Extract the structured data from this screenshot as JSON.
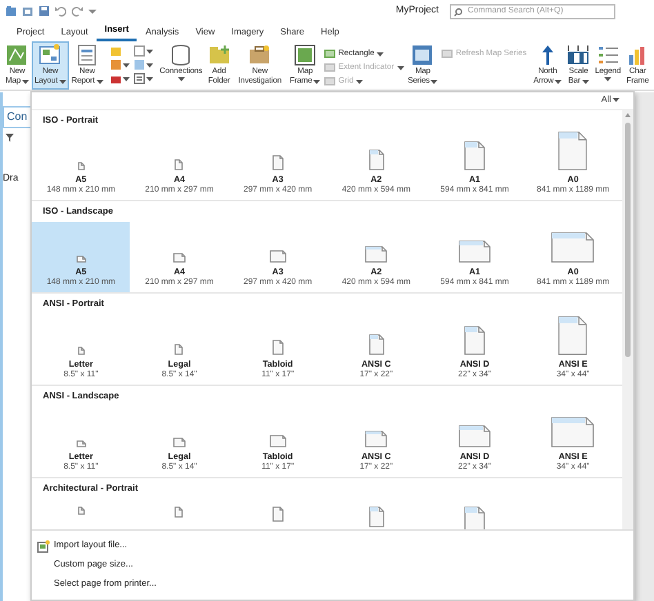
{
  "title_bar": {
    "title": "MyProject",
    "search": {
      "placeholder": "Command Search (Alt+Q)"
    }
  },
  "tabs": [
    {
      "label": "Project",
      "selected": false
    },
    {
      "label": "Layout",
      "selected": false
    },
    {
      "label": "Insert",
      "selected": true
    },
    {
      "label": "Analysis",
      "selected": false
    },
    {
      "label": "View",
      "selected": false
    },
    {
      "label": "Imagery",
      "selected": false
    },
    {
      "label": "Share",
      "selected": false
    },
    {
      "label": "Help",
      "selected": false
    }
  ],
  "ribbon": [
    {
      "kind": "large",
      "label": "New Map",
      "dropdown": true,
      "selected": false
    },
    {
      "kind": "large",
      "label": "New Layout",
      "dropdown": true,
      "selected": true
    },
    {
      "kind": "large",
      "label": "New Report",
      "dropdown": true,
      "selected": false
    },
    {
      "kind": "icons",
      "items": [
        {
          "dropdown": false
        },
        {
          "dropdown": true
        },
        {
          "dropdown": true
        },
        {
          "dropdown": true
        },
        {
          "dropdown": true
        },
        {
          "dropdown": true
        }
      ]
    },
    {
      "kind": "large",
      "label": "Connections",
      "dropdown": true,
      "selected": false
    },
    {
      "kind": "large",
      "label": "Add Folder",
      "dropdown": false,
      "selected": false
    },
    {
      "kind": "separator"
    },
    {
      "kind": "large",
      "label": "New Investigation",
      "dropdown": false,
      "selected": false
    },
    {
      "kind": "separator"
    },
    {
      "kind": "large",
      "label": "Map Frame",
      "dropdown": true,
      "selected": false
    },
    {
      "kind": "small",
      "items": [
        {
          "label": "Rectangle",
          "dropdown": true,
          "disabled": false
        },
        {
          "label": "Extent Indicator",
          "dropdown": true,
          "disabled": true
        },
        {
          "label": "Grid",
          "dropdown": true,
          "disabled": true
        }
      ]
    },
    {
      "kind": "large",
      "label": "Map Series",
      "dropdown": true,
      "selected": false
    },
    {
      "kind": "small",
      "items": [
        {
          "label": "Refresh Map Series",
          "dropdown": false,
          "disabled": true
        }
      ]
    },
    {
      "kind": "separator"
    },
    {
      "kind": "large",
      "label": "North Arrow",
      "dropdown": true,
      "selected": false
    },
    {
      "kind": "large",
      "label": "Scale Bar",
      "dropdown": true,
      "selected": false
    },
    {
      "kind": "large",
      "label": "Legend",
      "dropdown": true,
      "selected": false
    },
    {
      "kind": "large",
      "label": "Char Frame",
      "dropdown": false,
      "selected": false
    }
  ],
  "side_panel": {
    "tab": "Con",
    "heading": "Dra"
  },
  "gallery": {
    "filter": "All",
    "sections": [
      {
        "title": "ISO - Portrait",
        "kind": "portrait",
        "items": [
          {
            "name": "A5",
            "size": "148 mm x 210 mm",
            "selected": false
          },
          {
            "name": "A4",
            "size": "210 mm x 297 mm",
            "selected": false
          },
          {
            "name": "A3",
            "size": "297 mm x 420 mm",
            "selected": false
          },
          {
            "name": "A2",
            "size": "420 mm x 594 mm",
            "selected": false
          },
          {
            "name": "A1",
            "size": "594 mm x 841 mm",
            "selected": false
          },
          {
            "name": "A0",
            "size": "841 mm x 1189 mm",
            "selected": false
          }
        ]
      },
      {
        "title": "ISO - Landscape",
        "kind": "landscape",
        "items": [
          {
            "name": "A5",
            "size": "148 mm x 210 mm",
            "selected": true
          },
          {
            "name": "A4",
            "size": "210 mm x 297 mm",
            "selected": false
          },
          {
            "name": "A3",
            "size": "297 mm x 420 mm",
            "selected": false
          },
          {
            "name": "A2",
            "size": "420 mm x 594 mm",
            "selected": false
          },
          {
            "name": "A1",
            "size": "594 mm x 841 mm",
            "selected": false
          },
          {
            "name": "A0",
            "size": "841 mm x 1189 mm",
            "selected": false
          }
        ]
      },
      {
        "title": "ANSI - Portrait",
        "kind": "portrait",
        "items": [
          {
            "name": "Letter",
            "size": "8.5\" x 11\"",
            "selected": false
          },
          {
            "name": "Legal",
            "size": "8.5\" x 14\"",
            "selected": false
          },
          {
            "name": "Tabloid",
            "size": "11\" x 17\"",
            "selected": false
          },
          {
            "name": "ANSI C",
            "size": "17\" x 22\"",
            "selected": false
          },
          {
            "name": "ANSI D",
            "size": "22\" x 34\"",
            "selected": false
          },
          {
            "name": "ANSI E",
            "size": "34\" x 44\"",
            "selected": false
          }
        ]
      },
      {
        "title": "ANSI - Landscape",
        "kind": "landscape",
        "items": [
          {
            "name": "Letter",
            "size": "8.5\" x 11\"",
            "selected": false
          },
          {
            "name": "Legal",
            "size": "8.5\" x 14\"",
            "selected": false
          },
          {
            "name": "Tabloid",
            "size": "11\" x 17\"",
            "selected": false
          },
          {
            "name": "ANSI C",
            "size": "17\" x 22\"",
            "selected": false
          },
          {
            "name": "ANSI D",
            "size": "22\" x 34\"",
            "selected": false
          },
          {
            "name": "ANSI E",
            "size": "34\" x 44\"",
            "selected": false
          }
        ]
      },
      {
        "title": "Architectural - Portrait",
        "kind": "portrait",
        "items": [
          {
            "selected": false
          },
          {
            "selected": false
          },
          {
            "selected": false
          },
          {
            "selected": false
          },
          {
            "selected": false
          }
        ]
      }
    ],
    "menu": [
      {
        "label": "Import layout file...",
        "kind": "icon"
      },
      {
        "label": "Custom page size...",
        "kind": "plain"
      },
      {
        "label": "Select page from printer...",
        "kind": "plain"
      }
    ]
  }
}
